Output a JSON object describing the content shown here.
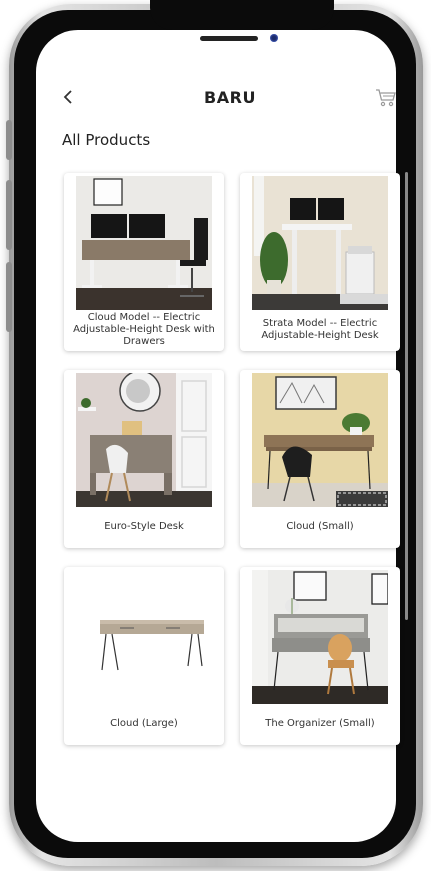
{
  "header": {
    "title": "BARU"
  },
  "section_title": "All Products",
  "icons": {
    "back": "chevron-left-icon",
    "cart": "shopping-cart-icon"
  },
  "products": [
    {
      "name": "Cloud Model -- Electric Adjustable-Height Desk with Drawers"
    },
    {
      "name": "Strata Model -- Electric Adjustable-Height Desk"
    },
    {
      "name": "Euro-Style Desk"
    },
    {
      "name": "Cloud (Small)"
    },
    {
      "name": "Cloud (Large)"
    },
    {
      "name": "The Organizer (Small)"
    }
  ]
}
